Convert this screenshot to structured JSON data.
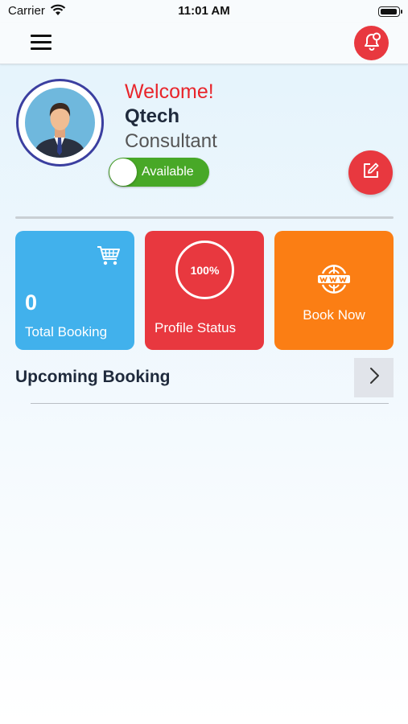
{
  "status_bar": {
    "carrier": "Carrier",
    "time": "11:01 AM"
  },
  "profile": {
    "welcome": "Welcome!",
    "name": "Qtech",
    "role": "Consultant",
    "availability_label": "Available",
    "availability_on": true
  },
  "cards": {
    "total_booking": {
      "count": "0",
      "label": "Total Booking",
      "icon": "cart-icon"
    },
    "profile_status": {
      "percent": "100%",
      "label": "Profile Status"
    },
    "book_now": {
      "label": "Book Now",
      "icon": "www-globe-icon"
    }
  },
  "upcoming": {
    "title": "Upcoming Booking"
  },
  "colors": {
    "red": "#e8383f",
    "blue": "#41b1ec",
    "orange": "#fb7e14",
    "green": "#48a827",
    "welcome_red": "#e8252b"
  }
}
